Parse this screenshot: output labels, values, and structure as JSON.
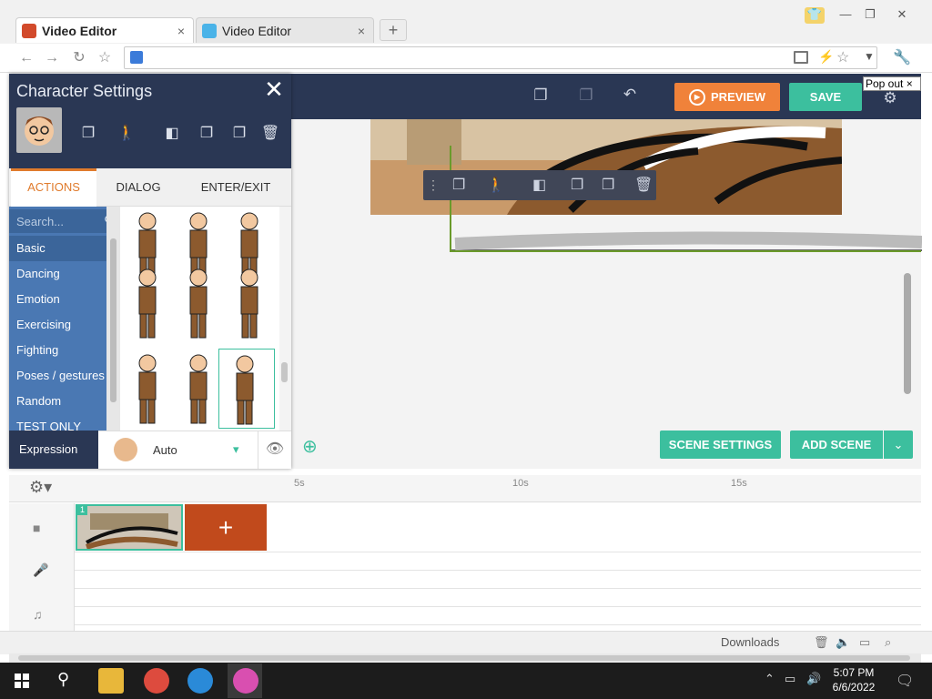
{
  "browser": {
    "tabs": [
      {
        "title": "Video Editor",
        "close": "×"
      },
      {
        "title": "Video Editor",
        "close": "×"
      }
    ],
    "new_tab": "+",
    "window_controls": [
      "—",
      "❐",
      "✕"
    ],
    "nav": [
      "←",
      "→",
      "↻",
      "☆"
    ],
    "downloads": "Downloads"
  },
  "app": {
    "preview_label": "PREVIEW",
    "save_label": "SAVE",
    "popout_label": "Pop out",
    "popout_close": "×",
    "scene_settings_label": "SCENE SETTINGS",
    "add_scene_label": "ADD SCENE",
    "add_scene_caret": "⌄"
  },
  "panel": {
    "title": "Character Settings",
    "close": "✕",
    "tabs": [
      "ACTIONS",
      "DIALOG",
      "ENTER/EXIT"
    ],
    "active_tab": "ACTIONS",
    "search_placeholder": "Search...",
    "categories": [
      "Basic",
      "Dancing",
      "Emotion",
      "Exercising",
      "Fighting",
      "Poses / gestures",
      "Random",
      "TEST ONLY"
    ],
    "selected_category": "Basic",
    "expression_label": "Expression",
    "expression_value": "Auto"
  },
  "timeline": {
    "ticks": [
      "5s",
      "10s",
      "15s"
    ],
    "clip_number": "1",
    "add_clip": "+"
  },
  "taskbar": {
    "time": "5:07 PM",
    "date": "6/6/2022"
  },
  "colors": {
    "header": "#2a3754",
    "accent": "#3cbf9e",
    "preview": "#f0823a",
    "category_bg": "#4a78b3",
    "active_tab": "#e07b2c"
  }
}
